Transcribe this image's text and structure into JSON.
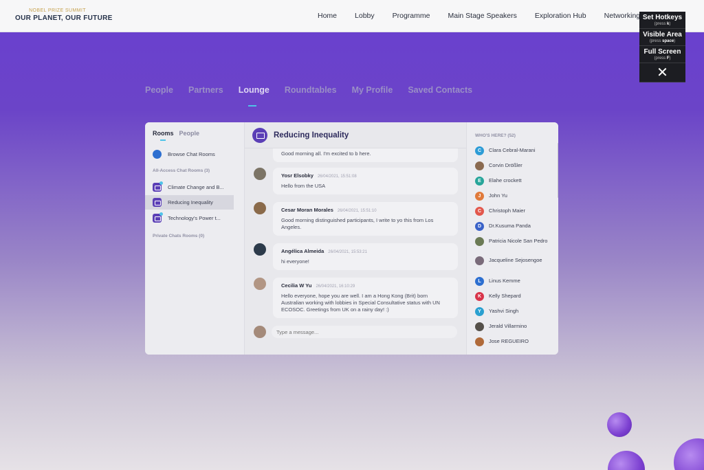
{
  "brand": {
    "small": "NOBEL PRIZE SUMMIT",
    "big": "OUR PLANET, OUR FUTURE"
  },
  "nav": [
    "Home",
    "Lobby",
    "Programme",
    "Main Stage Speakers",
    "Exploration Hub",
    "Networking"
  ],
  "hotkeys": [
    {
      "title": "Set Hotkeys",
      "hint_pre": "(press ",
      "key": "k",
      "hint_post": ")"
    },
    {
      "title": "Visible Area",
      "hint_pre": "(press ",
      "key": "space",
      "hint_post": ")"
    },
    {
      "title": "Full Screen",
      "hint_pre": "(press ",
      "key": "F",
      "hint_post": ")"
    }
  ],
  "page_tabs": [
    "People",
    "Partners",
    "Lounge",
    "Roundtables",
    "My Profile",
    "Saved Contacts"
  ],
  "left": {
    "tabs": [
      "Rooms",
      "People"
    ],
    "browse": "Browse Chat Rooms",
    "all_access_header": "All-Access Chat Rooms (3)",
    "rooms": [
      "Climate Change and B...",
      "Reducing Inequality",
      "Technology's Power t..."
    ],
    "private_header": "Private Chats Rooms (0)"
  },
  "chat": {
    "title": "Reducing Inequality",
    "messages": [
      {
        "name": "",
        "time": "",
        "text": "Good morning all. I'm excited to b here."
      },
      {
        "name": "Yosr Elsobky",
        "time": "26/04/2021, 15:51:08",
        "text": "Hello from the USA"
      },
      {
        "name": "Cesar Moran Morales",
        "time": "26/04/2021, 15:51:10",
        "text": "Good morning distinguished participants, I write to yo this from Los Angeles."
      },
      {
        "name": "Angélica Almeida",
        "time": "26/04/2021, 15:53:21",
        "text": "hi everyone!"
      },
      {
        "name": "Cecilia W Yu",
        "time": "26/04/2021, 16:10:29",
        "text": "Hello everyone, hope you are well. I am a Hong Kong (Brit) born Australian working with lobbies in Special Consultative status with UN ECOSOC. Greetings from UK on a rainy day! :)"
      }
    ],
    "compose_placeholder": "Type a message..."
  },
  "participants": {
    "header": "WHO'S HERE? (52)",
    "list": [
      {
        "name": "Clara Cebral-Marani",
        "initial": "C",
        "color": "#2d9cd6"
      },
      {
        "name": "Corvin Drößler",
        "initial": "",
        "color": "#8a6a50"
      },
      {
        "name": "Elahe crockett",
        "initial": "E",
        "color": "#27a59a"
      },
      {
        "name": "John Yu",
        "initial": "J",
        "color": "#e07a3b"
      },
      {
        "name": "Christoph Maier",
        "initial": "C",
        "color": "#e2574c"
      },
      {
        "name": "Dr.Kusuma Panda",
        "initial": "D",
        "color": "#3a62c8"
      },
      {
        "name": "Patricia Nicole San Pedro",
        "initial": "",
        "color": "#6b7a55"
      },
      {
        "name": "Jacqueline Sejosengoe",
        "initial": "",
        "color": "#7a6b7a"
      },
      {
        "name": "Linus Kemme",
        "initial": "L",
        "color": "#2d6fd0"
      },
      {
        "name": "Kelly Shepard",
        "initial": "K",
        "color": "#d8344a"
      },
      {
        "name": "Yashvi Singh",
        "initial": "Y",
        "color": "#2aa0d0"
      },
      {
        "name": "Jerald Villarmino",
        "initial": "",
        "color": "#55504a"
      },
      {
        "name": "Jose REGUEIRO",
        "initial": "",
        "color": "#b06a3a"
      }
    ]
  },
  "colors": {
    "accent": "#4fc3e8",
    "brand_purple": "#5b3fb6",
    "active_tab": "#ded7f2"
  }
}
